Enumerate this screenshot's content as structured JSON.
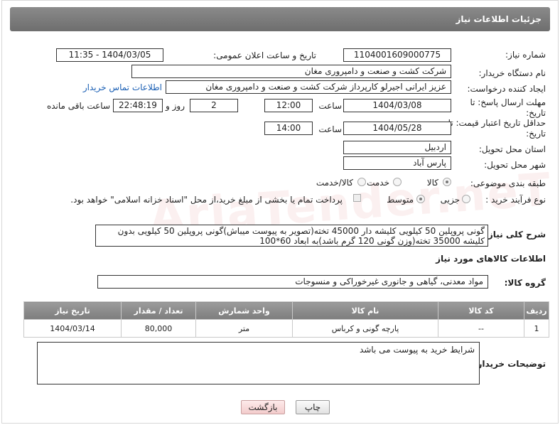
{
  "header": {
    "title": "جزئیات اطلاعات نیاز"
  },
  "need_number": {
    "label": "شماره نیاز:",
    "value": "1104001609000775"
  },
  "announce": {
    "label": "تاریخ و ساعت اعلان عمومی:",
    "value": "1404/03/05 - 11:35"
  },
  "buyer_org": {
    "label": "نام دستگاه خریدار:",
    "value": "شرکت کشت و صنعت و دامپروری مغان"
  },
  "requester": {
    "label": "ایجاد کننده درخواست:",
    "value": "عزیز ایرانی اجیرلو کارپرداز شرکت کشت و صنعت و دامپروری مغان",
    "contact_link": "اطلاعات تماس خریدار"
  },
  "deadline": {
    "label": "مهلت ارسال پاسخ: تا تاریخ:",
    "date": "1404/03/08",
    "time_label": "ساعت",
    "time": "12:00",
    "days": "2",
    "days_label": "روز و",
    "remaining": "22:48:19",
    "remaining_label": "ساعت باقی مانده"
  },
  "validity": {
    "label": "حداقل تاریخ اعتبار قیمت: تا تاریخ:",
    "date": "1404/05/28",
    "time_label": "ساعت",
    "time": "14:00"
  },
  "province": {
    "label": "استان محل تحویل:",
    "value": "اردبیل"
  },
  "city": {
    "label": "شهر محل تحویل:",
    "value": "پارس آباد"
  },
  "category": {
    "label": "طبقه بندی موضوعی:",
    "options": [
      "کالا",
      "خدمت",
      "کالا/خدمت"
    ]
  },
  "process": {
    "label": "نوع فرآیند خرید :",
    "options": [
      "جزیی",
      "متوسط"
    ],
    "payment_note": "پرداخت تمام یا بخشی از مبلغ خرید،از محل \"اسناد خزانه اسلامی\" خواهد بود."
  },
  "description": {
    "label": "شرح کلی نیاز:",
    "value": "گونی پروپلین 50 کیلویی کلیشه دار 45000 تخته(تصویر به پیوست میباش)گونی پروپلین 50 کیلویی بدون کلیشه 35000 تخته(وزن گونی 120 گرم باشد)به ابعاد 60*100"
  },
  "goods_info": {
    "title": "اطلاعات کالاهای مورد نیاز"
  },
  "goods_group": {
    "label": "گروه کالا:",
    "value": "مواد معدنی، گیاهی و جانوری غیرخوراکی و منسوجات"
  },
  "table": {
    "headers": [
      "ردیف",
      "کد کالا",
      "نام کالا",
      "واحد شمارش",
      "تعداد / مقدار",
      "تاریخ نیاز"
    ],
    "rows": [
      [
        "1",
        "--",
        "پارچه گونی و کرباس",
        "متر",
        "80,000",
        "1404/03/14"
      ]
    ]
  },
  "buyer_notes": {
    "label": "توضیحات خریدار:",
    "value": "شرایط خرید به پیوست می باشد"
  },
  "buttons": {
    "print": "چاپ",
    "back": "بازگشت"
  },
  "watermark": "AriaTender.neT"
}
